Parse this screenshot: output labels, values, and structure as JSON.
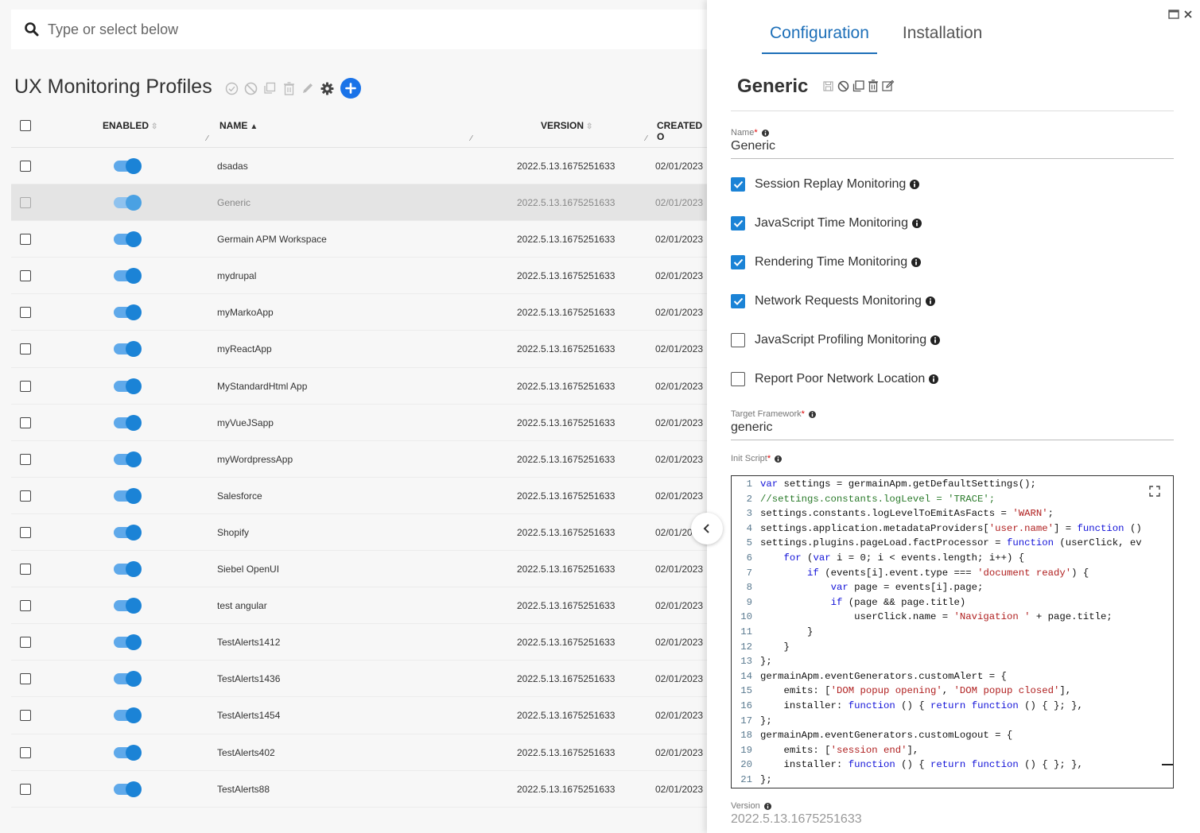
{
  "search": {
    "placeholder": "Type or select below"
  },
  "list": {
    "title": "UX Monitoring Profiles",
    "columns": {
      "enabled": "ENABLED",
      "name": "NAME",
      "version": "VERSION",
      "created": "CREATED O"
    },
    "rows": [
      {
        "name": "dsadas",
        "version": "2022.5.13.1675251633",
        "created": "02/01/2023",
        "enabled": true,
        "selected": false
      },
      {
        "name": "Generic",
        "version": "2022.5.13.1675251633",
        "created": "02/01/2023",
        "enabled": true,
        "selected": true
      },
      {
        "name": "Germain APM Workspace",
        "version": "2022.5.13.1675251633",
        "created": "02/01/2023",
        "enabled": true,
        "selected": false
      },
      {
        "name": "mydrupal",
        "version": "2022.5.13.1675251633",
        "created": "02/01/2023",
        "enabled": true,
        "selected": false
      },
      {
        "name": "myMarkoApp",
        "version": "2022.5.13.1675251633",
        "created": "02/01/2023",
        "enabled": true,
        "selected": false
      },
      {
        "name": "myReactApp",
        "version": "2022.5.13.1675251633",
        "created": "02/01/2023",
        "enabled": true,
        "selected": false
      },
      {
        "name": "MyStandardHtml App",
        "version": "2022.5.13.1675251633",
        "created": "02/01/2023",
        "enabled": true,
        "selected": false
      },
      {
        "name": "myVueJSapp",
        "version": "2022.5.13.1675251633",
        "created": "02/01/2023",
        "enabled": true,
        "selected": false
      },
      {
        "name": "myWordpressApp",
        "version": "2022.5.13.1675251633",
        "created": "02/01/2023",
        "enabled": true,
        "selected": false
      },
      {
        "name": "Salesforce",
        "version": "2022.5.13.1675251633",
        "created": "02/01/2023",
        "enabled": true,
        "selected": false
      },
      {
        "name": "Shopify",
        "version": "2022.5.13.1675251633",
        "created": "02/01/20",
        "enabled": true,
        "selected": false
      },
      {
        "name": "Siebel OpenUI",
        "version": "2022.5.13.1675251633",
        "created": "02/01/2023",
        "enabled": true,
        "selected": false
      },
      {
        "name": "test angular",
        "version": "2022.5.13.1675251633",
        "created": "02/01/2023",
        "enabled": true,
        "selected": false
      },
      {
        "name": "TestAlerts1412",
        "version": "2022.5.13.1675251633",
        "created": "02/01/2023",
        "enabled": true,
        "selected": false
      },
      {
        "name": "TestAlerts1436",
        "version": "2022.5.13.1675251633",
        "created": "02/01/2023",
        "enabled": true,
        "selected": false
      },
      {
        "name": "TestAlerts1454",
        "version": "2022.5.13.1675251633",
        "created": "02/01/2023",
        "enabled": true,
        "selected": false
      },
      {
        "name": "TestAlerts402",
        "version": "2022.5.13.1675251633",
        "created": "02/01/2023",
        "enabled": true,
        "selected": false
      },
      {
        "name": "TestAlerts88",
        "version": "2022.5.13.1675251633",
        "created": "02/01/2023",
        "enabled": true,
        "selected": false
      }
    ]
  },
  "detail": {
    "tabs": [
      {
        "label": "Configuration",
        "active": true
      },
      {
        "label": "Installation",
        "active": false
      }
    ],
    "profile_title": "Generic",
    "name_label": "Name",
    "name_value": "Generic",
    "checkboxes": [
      {
        "label": "Session Replay Monitoring",
        "checked": true
      },
      {
        "label": "JavaScript Time Monitoring",
        "checked": true
      },
      {
        "label": "Rendering Time Monitoring",
        "checked": true
      },
      {
        "label": "Network Requests Monitoring",
        "checked": true
      },
      {
        "label": "JavaScript Profiling Monitoring",
        "checked": false
      },
      {
        "label": "Report Poor Network Location",
        "checked": false
      }
    ],
    "framework_label": "Target Framework",
    "framework_value": "generic",
    "init_script_label": "Init Script",
    "version_label": "Version",
    "version_value": "2022.5.13.1675251633"
  },
  "code_lines": [
    "var settings = germainApm.getDefaultSettings();",
    "//settings.constants.logLevel = 'TRACE';",
    "settings.constants.logLevelToEmitAsFacts = 'WARN';",
    "settings.application.metadataProviders['user.name'] = function ()",
    "settings.plugins.pageLoad.factProcessor = function (userClick, ev",
    "    for (var i = 0; i < events.length; i++) {",
    "        if (events[i].event.type === 'document ready') {",
    "            var page = events[i].page;",
    "            if (page && page.title)",
    "                userClick.name = 'Navigation ' + page.title;",
    "        }",
    "    }",
    "};",
    "germainApm.eventGenerators.customAlert = {",
    "    emits: ['DOM popup opening', 'DOM popup closed'],",
    "    installer: function () { return function () { }; },",
    "};",
    "germainApm.eventGenerators.customLogout = {",
    "    emits: ['session end'],",
    "    installer: function () { return function () { }; },",
    "};"
  ],
  "colors": {
    "accent": "#1b83d6",
    "tab_active": "#1d6fb8",
    "add_button": "#1a73e8"
  }
}
